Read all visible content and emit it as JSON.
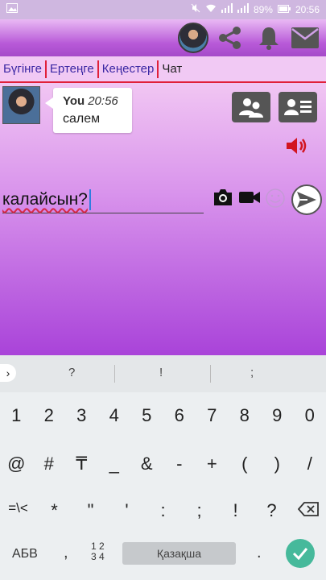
{
  "status": {
    "time": "20:56",
    "battery": "89%"
  },
  "tabs": [
    {
      "label": "Бүгінге"
    },
    {
      "label": "Ертеңге"
    },
    {
      "label": "Кеңестер"
    },
    {
      "label": "Чат",
      "active": true
    }
  ],
  "chat": {
    "messages": [
      {
        "author": "You",
        "time": "20:56",
        "text": "салем"
      }
    ]
  },
  "composer": {
    "value": "калайсын?"
  },
  "keyboard": {
    "suggestions": [
      "?",
      "!",
      ";"
    ],
    "row1": [
      "1",
      "2",
      "3",
      "4",
      "5",
      "6",
      "7",
      "8",
      "9",
      "0"
    ],
    "row2": [
      "@",
      "#",
      "₸",
      "_",
      "&",
      "-",
      "+",
      "(",
      ")",
      "/"
    ],
    "row3": [
      "=\\<",
      "*",
      "\"",
      "'",
      ":",
      ";",
      "!",
      "?"
    ],
    "bottom": {
      "lang_key": "АБВ",
      "comma": ",",
      "num_top": "1 2",
      "num_bottom": "3 4",
      "space_label": "Қазақша",
      "period": "."
    }
  },
  "colors": {
    "tab_accent": "#e0203a",
    "tab_text": "#3b27a3",
    "enter": "#46b99b"
  }
}
